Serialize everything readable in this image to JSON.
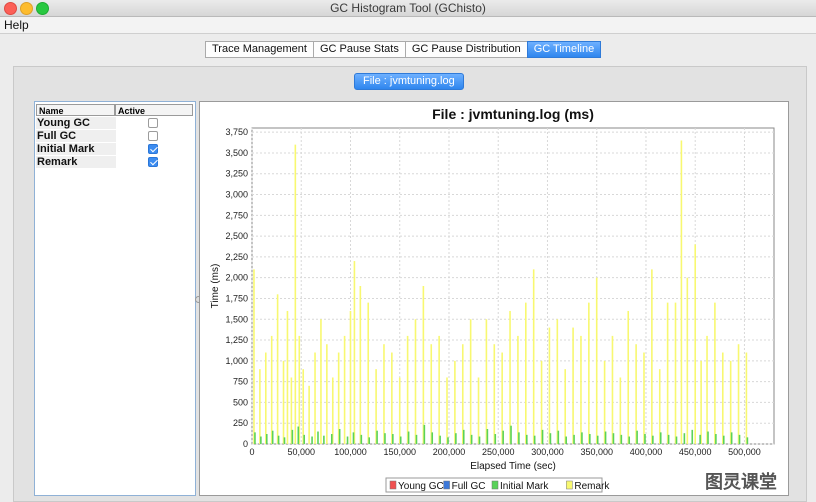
{
  "window": {
    "title": "GC Histogram Tool (GChisto)"
  },
  "menu": {
    "items": [
      "Help"
    ]
  },
  "tabs": [
    {
      "label": "Trace Management",
      "active": false
    },
    {
      "label": "GC Pause Stats",
      "active": false
    },
    {
      "label": "GC Pause Distribution",
      "active": false
    },
    {
      "label": "GC Timeline",
      "active": true
    }
  ],
  "file_button": {
    "label": "File : jvmtuning.log"
  },
  "gc_table": {
    "headers": {
      "name": "Name",
      "active": "Active"
    },
    "rows": [
      {
        "name": "Young GC",
        "active": false
      },
      {
        "name": "Full GC",
        "active": false
      },
      {
        "name": "Initial Mark",
        "active": true
      },
      {
        "name": "Remark",
        "active": true
      }
    ]
  },
  "chart_data": {
    "type": "bar",
    "title": "File : jvmtuning.log (ms)",
    "xlabel": "Elapsed Time (sec)",
    "ylabel": "Time (ms)",
    "xlim": [
      0,
      530000
    ],
    "ylim": [
      0,
      3800
    ],
    "x_ticks": [
      "0",
      "50,000",
      "100,000",
      "150,000",
      "200,000",
      "250,000",
      "300,000",
      "350,000",
      "400,000",
      "450,000",
      "500,000"
    ],
    "y_ticks": [
      "0",
      "250",
      "500",
      "750",
      "1,000",
      "1,250",
      "1,500",
      "1,750",
      "2,000",
      "2,250",
      "2,500",
      "2,750",
      "3,000",
      "3,250",
      "3,500",
      "3,750"
    ],
    "grid": true,
    "legend": [
      {
        "name": "Young GC",
        "color": "#f05050"
      },
      {
        "name": "Full GC",
        "color": "#3c78d8"
      },
      {
        "name": "Initial Mark",
        "color": "#5ad25a"
      },
      {
        "name": "Remark",
        "color": "#f8f870"
      }
    ],
    "series": [
      {
        "name": "Remark",
        "color": "#f8f870",
        "x": [
          2000,
          8000,
          14000,
          20000,
          26000,
          32000,
          36000,
          40000,
          44000,
          48000,
          52000,
          58000,
          64000,
          70000,
          76000,
          82000,
          88000,
          94000,
          100000,
          104000,
          110000,
          118000,
          126000,
          134000,
          142000,
          150000,
          158000,
          166000,
          174000,
          182000,
          190000,
          198000,
          206000,
          214000,
          222000,
          230000,
          238000,
          246000,
          254000,
          262000,
          270000,
          278000,
          286000,
          294000,
          302000,
          310000,
          318000,
          326000,
          334000,
          342000,
          350000,
          358000,
          366000,
          374000,
          382000,
          390000,
          398000,
          406000,
          414000,
          422000,
          430000,
          436000,
          442000,
          450000,
          456000,
          462000,
          470000,
          478000,
          486000,
          494000,
          502000
        ],
        "values": [
          2100,
          900,
          1100,
          1300,
          1800,
          1000,
          1600,
          800,
          3600,
          1300,
          900,
          700,
          1100,
          1500,
          1200,
          800,
          1100,
          1300,
          1600,
          2200,
          1900,
          1700,
          900,
          1200,
          1100,
          800,
          1300,
          1500,
          1900,
          1200,
          1300,
          800,
          1000,
          1200,
          1500,
          800,
          1500,
          1200,
          1100,
          1600,
          1300,
          1700,
          2100,
          1000,
          1400,
          1500,
          900,
          1400,
          1300,
          1700,
          2000,
          1000,
          1300,
          800,
          1600,
          1200,
          1100,
          2100,
          900,
          1700,
          1700,
          3650,
          2000,
          2400,
          1000,
          1300,
          1700,
          1100,
          1000,
          1200,
          1100
        ]
      },
      {
        "name": "Initial Mark",
        "color": "#5ad25a",
        "x": [
          3000,
          9000,
          15000,
          21000,
          27000,
          33000,
          41000,
          47000,
          53000,
          61000,
          67000,
          73000,
          81000,
          89000,
          97000,
          103000,
          111000,
          119000,
          127000,
          135000,
          143000,
          151000,
          159000,
          167000,
          175000,
          183000,
          191000,
          199000,
          207000,
          215000,
          223000,
          231000,
          239000,
          247000,
          255000,
          263000,
          271000,
          279000,
          287000,
          295000,
          303000,
          311000,
          319000,
          327000,
          335000,
          343000,
          351000,
          359000,
          367000,
          375000,
          383000,
          391000,
          399000,
          407000,
          415000,
          423000,
          431000,
          439000,
          447000,
          455000,
          463000,
          471000,
          479000,
          487000,
          495000,
          503000
        ],
        "values": [
          140,
          90,
          120,
          160,
          100,
          80,
          170,
          210,
          110,
          90,
          150,
          100,
          120,
          180,
          90,
          140,
          110,
          80,
          160,
          130,
          120,
          90,
          150,
          110,
          230,
          140,
          100,
          80,
          130,
          170,
          110,
          90,
          180,
          120,
          160,
          220,
          140,
          110,
          100,
          170,
          130,
          160,
          90,
          110,
          140,
          120,
          100,
          150,
          130,
          110,
          90,
          160,
          120,
          100,
          140,
          110,
          90,
          130,
          170,
          110,
          150,
          120,
          100,
          140,
          110,
          80
        ]
      }
    ]
  }
}
